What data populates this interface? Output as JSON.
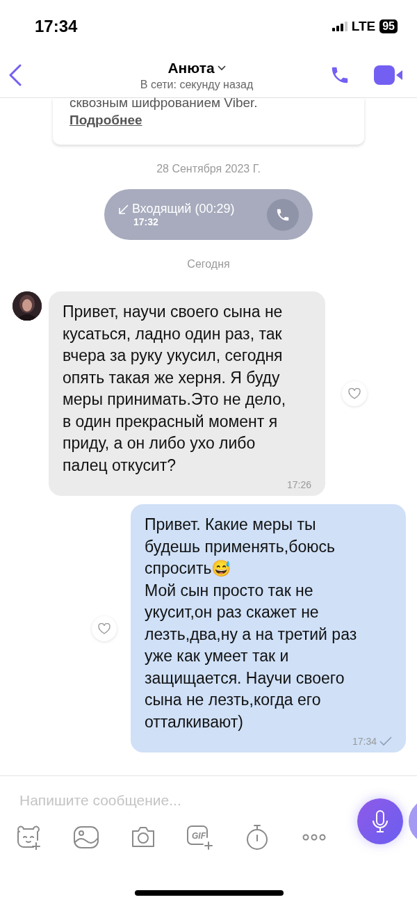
{
  "status_bar": {
    "time": "17:34",
    "network": "LTE",
    "battery": "95"
  },
  "header": {
    "name": "Анюта",
    "status": "В сети: секунду назад"
  },
  "encryption_notice": {
    "text": "сквозным шифрованием Viber.",
    "link": "Подробнее"
  },
  "messages": [
    {
      "kind": "date",
      "text": "28 Сентября 2023 Г."
    },
    {
      "kind": "call",
      "text": "Входящий (00:29)",
      "time": "17:32"
    },
    {
      "kind": "date",
      "text": "Сегодня"
    },
    {
      "kind": "incoming",
      "text": "Привет, научи своего сына не кусаться, ладно один раз, так вчера за руку укусил, сегодня опять такая же херня. Я буду меры принимать.Это не дело, в один прекрасный момент я приду, а он либо ухо либо палец откусит?",
      "time": "17:26",
      "liked": false
    },
    {
      "kind": "outgoing",
      "text": "Привет. Какие меры ты будешь применять,боюсь спросить😅\nМой сын просто так не укусит,он раз скажет не лезть,два,ну а на третий раз уже как умеет так и защищается. Научи своего сына не лезть,когда его отталкивают)",
      "time": "17:34",
      "read": true,
      "liked": false
    }
  ],
  "composer": {
    "placeholder": "Напишите сообщение...",
    "tools": [
      {
        "kind": "sticker"
      },
      {
        "kind": "gallery"
      },
      {
        "kind": "camera"
      },
      {
        "kind": "gif",
        "label": "GIF"
      },
      {
        "kind": "timer"
      },
      {
        "kind": "more"
      }
    ]
  }
}
